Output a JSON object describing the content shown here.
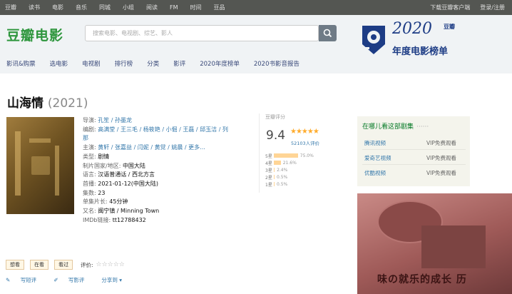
{
  "topnav": {
    "items": [
      "豆瓣",
      "读书",
      "电影",
      "音乐",
      "同城",
      "小组",
      "阅读",
      "FM",
      "时间",
      "豆品"
    ],
    "download": "下载豆瓣客户端",
    "login": "登录/注册"
  },
  "header": {
    "logo": "豆瓣电影",
    "search_placeholder": "搜索电影、电视剧、综艺、影人",
    "subnav": [
      "影讯&购票",
      "选电影",
      "电视剧",
      "排行榜",
      "分类",
      "影评",
      "2020年度榜单",
      "2020书影音报告"
    ]
  },
  "banner": {
    "year": "2020",
    "brand": "豆瓣",
    "subtitle": "年度电影榜单"
  },
  "movie": {
    "title": "山海情",
    "year": "(2021)"
  },
  "info": {
    "director_label": "导演:",
    "director": "孔笙 / 孙墨龙",
    "writer_label": "编剧:",
    "writer_line1": "高满堂 / 王三毛 / 杨筱艳 / 小倔 / 王磊 / 邱玉洁 / 列",
    "writer_line2": "那",
    "cast_label": "主演:",
    "cast": "黄轩 / 张嘉益 / 闫妮 / 黄觉 / 姚晨 / 更多...",
    "genre_label": "类型:",
    "genre": "剧情",
    "country_label": "制片国家/地区:",
    "country": "中国大陆",
    "language_label": "语言:",
    "language": "汉语普通话 / 西北方言",
    "premiere_label": "首播:",
    "premiere": "2021-01-12(中国大陆)",
    "episodes_label": "集数:",
    "episodes": "23",
    "runtime_label": "单集片长:",
    "runtime": "45分钟",
    "aka_label": "又名:",
    "aka": "闽宁镇 / Minning Town",
    "imdb_label": "IMDb链接:",
    "imdb": "tt12788432"
  },
  "rating": {
    "label": "豆瓣评分",
    "score": "9.4",
    "stars": "★★★★★",
    "count": "52103人评价",
    "rows": [
      {
        "label": "5星",
        "pct_value": 75.0,
        "pct": "75.0%"
      },
      {
        "label": "4星",
        "pct_value": 21.6,
        "pct": "21.6%"
      },
      {
        "label": "3星",
        "pct_value": 2.4,
        "pct": "2.4%"
      },
      {
        "label": "2星",
        "pct_value": 0.5,
        "pct": "0.5%"
      },
      {
        "label": "1星",
        "pct_value": 0.5,
        "pct": "0.5%"
      }
    ]
  },
  "actions": {
    "want": "想看",
    "watching": "在看",
    "watched": "看过",
    "eval_label": "评价:",
    "empty_stars": "☆☆☆☆☆",
    "short_review": "写短评",
    "review": "写影评",
    "share": "分享到 ▾"
  },
  "watch": {
    "heading": "在哪儿看这部剧集",
    "dots": "······",
    "platforms": [
      {
        "name": "腾讯视频",
        "meta": "VIP免费观看"
      },
      {
        "name": "爱奇艺视频",
        "meta": "VIP免费观看"
      },
      {
        "name": "优酷视频",
        "meta": "VIP免费观看"
      }
    ]
  },
  "ad": {
    "text": "味の就乐的成长 历"
  }
}
